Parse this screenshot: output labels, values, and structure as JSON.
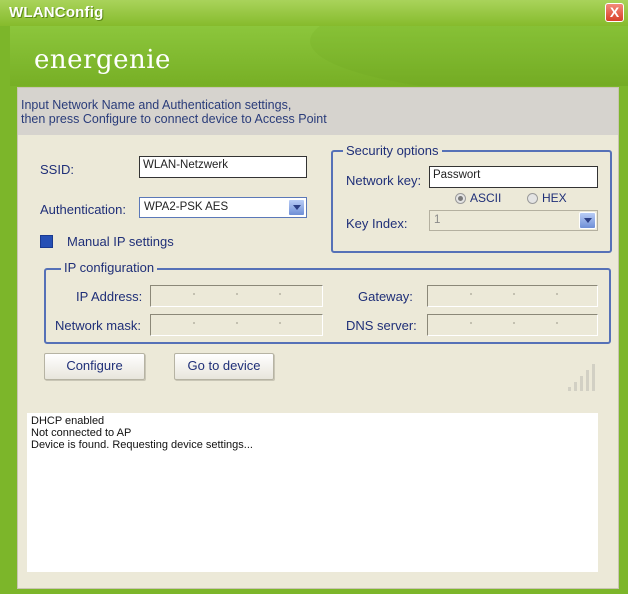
{
  "window": {
    "title": "WLANConfig",
    "close_glyph": "X",
    "accent": "#7cb62a"
  },
  "banner": {
    "logo_text": "energenie"
  },
  "instructions": "Input Network Name and Authentication settings,\nthen press Configure to connect device to Access Point",
  "ssid": {
    "label": "SSID:",
    "value": "WLAN-Netzwerk"
  },
  "authentication": {
    "label": "Authentication:",
    "value": "WPA2-PSK AES"
  },
  "manual_ip": {
    "label": "Manual IP settings",
    "checked": true
  },
  "security": {
    "title": "Security options",
    "network_key_label": "Network key:",
    "network_key_value": "Passwort",
    "ascii_label": "ASCII",
    "hex_label": "HEX",
    "selected_encoding": "ASCII",
    "key_index_label": "Key Index:",
    "key_index_value": "1"
  },
  "ip_config": {
    "title": "IP configuration",
    "ip_address_label": "IP Address:",
    "gateway_label": "Gateway:",
    "network_mask_label": "Network mask:",
    "dns_server_label": "DNS server:"
  },
  "buttons": {
    "configure": "Configure",
    "go_to_device": "Go to device"
  },
  "signal": {
    "icon": "signal-strength-icon"
  },
  "log": [
    "DHCP enabled",
    "Not connected to AP",
    "Device is found. Requesting device settings..."
  ]
}
